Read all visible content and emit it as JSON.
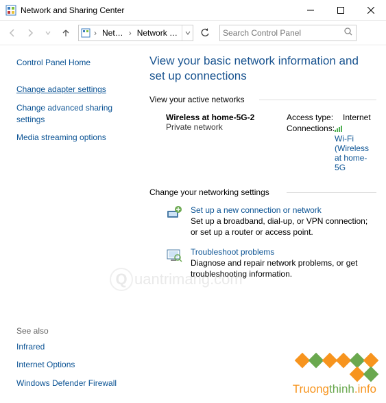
{
  "titlebar": {
    "title": "Network and Sharing Center"
  },
  "breadcrumb": {
    "seg1": "Net…",
    "seg2": "Network …"
  },
  "search": {
    "placeholder": "Search Control Panel"
  },
  "sidebar": {
    "home": "Control Panel Home",
    "links": [
      "Change adapter settings",
      "Change advanced sharing settings",
      "Media streaming options"
    ],
    "seealso_header": "See also",
    "seealso": [
      "Infrared",
      "Internet Options",
      "Windows Defender Firewall"
    ]
  },
  "main": {
    "heading": "View your basic network information and set up connections",
    "active_h": "View your active networks",
    "network": {
      "name": "Wireless at home-5G-2",
      "type": "Private network",
      "access_k": "Access type:",
      "access_v": "Internet",
      "conn_k": "Connections:",
      "conn_v": "Wi-Fi (Wireless at home-5G"
    },
    "change_h": "Change your networking settings",
    "items": [
      {
        "title": "Set up a new connection or network",
        "desc": "Set up a broadband, dial-up, or VPN connection; or set up a router or access point."
      },
      {
        "title": "Troubleshoot problems",
        "desc": "Diagnose and repair network problems, or get troubleshooting information."
      }
    ]
  },
  "watermarks": {
    "q": "uantrimang.com",
    "t1": "Truong",
    "t2": "thinh",
    "t3": ".info"
  }
}
